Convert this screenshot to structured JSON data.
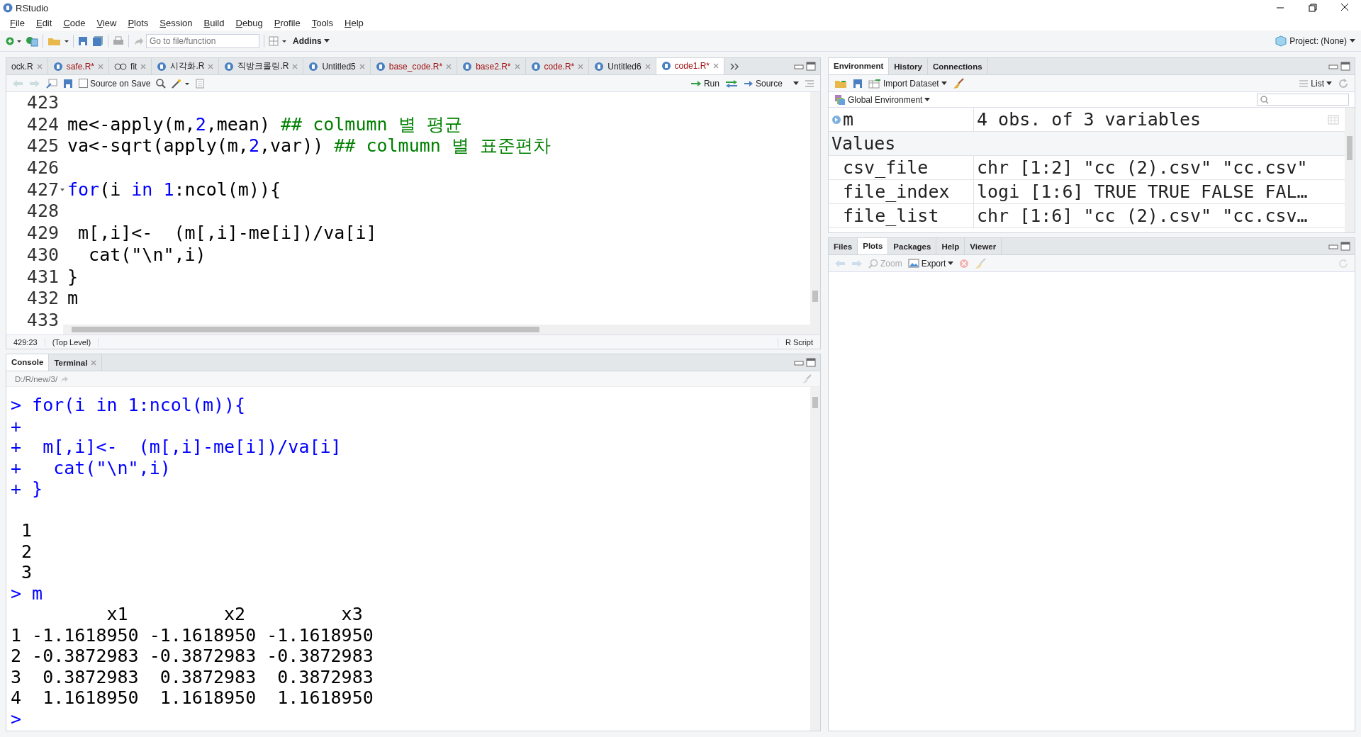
{
  "window": {
    "title": "RStudio"
  },
  "menu": [
    "File",
    "Edit",
    "Code",
    "View",
    "Plots",
    "Session",
    "Build",
    "Debug",
    "Profile",
    "Tools",
    "Help"
  ],
  "toolbar": {
    "goto_placeholder": "Go to file/function",
    "addins": "Addins",
    "project": "Project: (None)"
  },
  "editor": {
    "tabs": [
      {
        "label": "ock.R",
        "kind": "plain",
        "modified": false,
        "selected": false
      },
      {
        "label": "safe.R*",
        "kind": "script",
        "modified": true,
        "selected": false
      },
      {
        "label": "fit",
        "kind": "viewer",
        "modified": false,
        "selected": false
      },
      {
        "label": "시각화.R",
        "kind": "script",
        "modified": false,
        "selected": false
      },
      {
        "label": "직방크롤링.R",
        "kind": "script",
        "modified": false,
        "selected": false
      },
      {
        "label": "Untitled5",
        "kind": "script",
        "modified": false,
        "selected": false
      },
      {
        "label": "base_code.R*",
        "kind": "script",
        "modified": true,
        "selected": false
      },
      {
        "label": "base2.R*",
        "kind": "script",
        "modified": true,
        "selected": false
      },
      {
        "label": "code.R*",
        "kind": "script",
        "modified": true,
        "selected": false
      },
      {
        "label": "Untitled6",
        "kind": "script",
        "modified": false,
        "selected": false
      },
      {
        "label": "code1.R*",
        "kind": "script",
        "modified": true,
        "selected": true
      }
    ],
    "toolbar": {
      "source_on_save": "Source on Save",
      "source_on_save_checked": false,
      "run": "Run",
      "source": "Source"
    },
    "lines": [
      {
        "number": "423",
        "fold": false
      },
      {
        "number": "424",
        "fold": false,
        "segments": [
          {
            "kind": "plain",
            "text": "me<-apply(m,"
          },
          {
            "kind": "number",
            "text": "2"
          },
          {
            "kind": "plain",
            "text": ",mean) "
          },
          {
            "kind": "comment",
            "text": "## colmumn 별 평균"
          }
        ]
      },
      {
        "number": "425",
        "fold": false,
        "segments": [
          {
            "kind": "plain",
            "text": "va<-sqrt(apply(m,"
          },
          {
            "kind": "number",
            "text": "2"
          },
          {
            "kind": "plain",
            "text": ",var)) "
          },
          {
            "kind": "comment",
            "text": "## colmumn 별 표준편차"
          }
        ]
      },
      {
        "number": "426",
        "fold": false
      },
      {
        "number": "427",
        "fold": true,
        "segments": [
          {
            "kind": "keyword",
            "text": "for"
          },
          {
            "kind": "plain",
            "text": "(i "
          },
          {
            "kind": "keyword",
            "text": "in"
          },
          {
            "kind": "number",
            "text": " 1"
          },
          {
            "kind": "plain",
            "text": ":ncol(m)){"
          }
        ]
      },
      {
        "number": "428",
        "fold": false
      },
      {
        "number": "429",
        "fold": false,
        "segments": [
          {
            "kind": "plain",
            "text": " m[,i]<-  (m[,i]-me[i])/va[i]"
          }
        ]
      },
      {
        "number": "430",
        "fold": false,
        "segments": [
          {
            "kind": "plain",
            "text": "  cat(\"\\n\",i)"
          }
        ]
      },
      {
        "number": "431",
        "fold": false,
        "segments": [
          {
            "kind": "plain",
            "text": "}"
          }
        ]
      },
      {
        "number": "432",
        "fold": false,
        "segments": [
          {
            "kind": "plain",
            "text": "m"
          }
        ]
      },
      {
        "number": "433",
        "fold": false
      }
    ],
    "status": {
      "position": "429:23",
      "scope": "(Top Level)",
      "type": "R Script"
    }
  },
  "console": {
    "tabs": [
      {
        "label": "Console",
        "selected": true,
        "closable": false
      },
      {
        "label": "Terminal",
        "selected": false,
        "closable": true
      }
    ],
    "path": "D:/R/new/3/",
    "lines": [
      {
        "kind": "input",
        "text": "> for(i in 1:ncol(m)){"
      },
      {
        "kind": "input",
        "text": "+"
      },
      {
        "kind": "input",
        "text": "+  m[,i]<-  (m[,i]-me[i])/va[i]"
      },
      {
        "kind": "input",
        "text": "+   cat(\"\\n\",i)"
      },
      {
        "kind": "input",
        "text": "+ }"
      },
      {
        "kind": "blank"
      },
      {
        "kind": "output",
        "text": " 1"
      },
      {
        "kind": "output",
        "text": " 2"
      },
      {
        "kind": "output",
        "text": " 3"
      },
      {
        "kind": "input",
        "text": "> m"
      },
      {
        "kind": "output",
        "text": "         x1         x2         x3"
      },
      {
        "kind": "output",
        "text": "1 -1.1618950 -1.1618950 -1.1618950"
      },
      {
        "kind": "output",
        "text": "2 -0.3872983 -0.3872983 -0.3872983"
      },
      {
        "kind": "output",
        "text": "3  0.3872983  0.3872983  0.3872983"
      },
      {
        "kind": "output",
        "text": "4  1.1618950  1.1618950  1.1618950"
      },
      {
        "kind": "input",
        "text": ">"
      }
    ]
  },
  "environment": {
    "tabs": [
      {
        "label": "Environment",
        "selected": true
      },
      {
        "label": "History",
        "selected": false
      },
      {
        "label": "Connections",
        "selected": false
      }
    ],
    "import": "Import Dataset",
    "view": "List",
    "scope": "Global Environment",
    "rows": [
      {
        "kind": "data",
        "name": "m",
        "value": "4 obs. of 3 variables"
      },
      {
        "kind": "section",
        "name": "Values"
      },
      {
        "kind": "value",
        "name": "csv_file",
        "value": "chr [1:2] \"cc (2).csv\" \"cc.csv\""
      },
      {
        "kind": "value",
        "name": "file_index",
        "value": "logi [1:6] TRUE TRUE FALSE FAL…"
      },
      {
        "kind": "value",
        "name": "file_list",
        "value": "chr [1:6] \"cc (2).csv\" \"cc.csv…"
      }
    ]
  },
  "files": {
    "tabs": [
      {
        "label": "Files",
        "selected": false
      },
      {
        "label": "Plots",
        "selected": true
      },
      {
        "label": "Packages",
        "selected": false
      },
      {
        "label": "Help",
        "selected": false
      },
      {
        "label": "Viewer",
        "selected": false
      }
    ],
    "zoom": "Zoom",
    "export": "Export"
  }
}
